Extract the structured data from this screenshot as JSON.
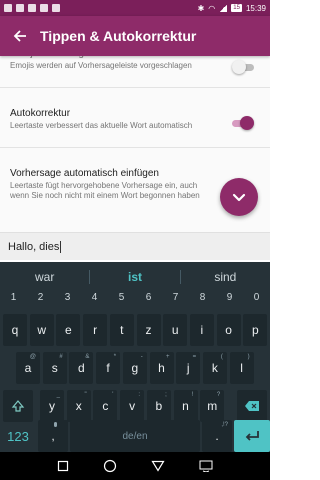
{
  "status_bar": {
    "battery": "15",
    "time": "15:39"
  },
  "app_bar": {
    "title": "Tippen & Autokorrektur"
  },
  "settings": [
    {
      "title": "Emoji-Vorhersagen",
      "subtitle": "Emojis werden auf Vorhersageleiste vorgeschlagen",
      "switch": "off"
    },
    {
      "title": "Autokorrektur",
      "subtitle": "Leertaste verbessert das aktuelle Wort automatisch",
      "switch": "on"
    },
    {
      "title": "Vorhersage automatisch einfügen",
      "subtitle": "Leertaste fügt hervorgehobene Vorhersage ein, auch wenn Sie noch nicht mit einem Wort begonnen haben"
    }
  ],
  "input": {
    "text": "Hallo, dies"
  },
  "keyboard": {
    "suggestions": [
      "war",
      "ist",
      "sind"
    ],
    "numbers": [
      "1",
      "2",
      "3",
      "4",
      "5",
      "6",
      "7",
      "8",
      "9",
      "0"
    ],
    "row1": [
      {
        "k": "q",
        "h": ""
      },
      {
        "k": "w",
        "h": ""
      },
      {
        "k": "e",
        "h": ""
      },
      {
        "k": "r",
        "h": ""
      },
      {
        "k": "t",
        "h": ""
      },
      {
        "k": "z",
        "h": ""
      },
      {
        "k": "u",
        "h": ""
      },
      {
        "k": "i",
        "h": ""
      },
      {
        "k": "o",
        "h": ""
      },
      {
        "k": "p",
        "h": ""
      }
    ],
    "row2": [
      {
        "k": "a",
        "h": "@"
      },
      {
        "k": "s",
        "h": "#"
      },
      {
        "k": "d",
        "h": "&"
      },
      {
        "k": "f",
        "h": "*"
      },
      {
        "k": "g",
        "h": "-"
      },
      {
        "k": "h",
        "h": "+"
      },
      {
        "k": "j",
        "h": "="
      },
      {
        "k": "k",
        "h": "("
      },
      {
        "k": "l",
        "h": ")"
      }
    ],
    "row3": [
      {
        "k": "y",
        "h": "_"
      },
      {
        "k": "x",
        "h": "\""
      },
      {
        "k": "c",
        "h": "'"
      },
      {
        "k": "v",
        "h": ":"
      },
      {
        "k": "b",
        "h": ";"
      },
      {
        "k": "n",
        "h": "!"
      },
      {
        "k": "m",
        "h": "?"
      }
    ],
    "row3_hint_extra": "€",
    "mode_key": "123",
    "comma_hint": "🎙",
    "space_label": "de/en",
    "punct_hint": ",!?",
    "dot_label": "."
  },
  "colors": {
    "accent": "#8e2b69",
    "keyboard_bg": "#263238",
    "suggestion_highlight": "#4fc3c5"
  }
}
